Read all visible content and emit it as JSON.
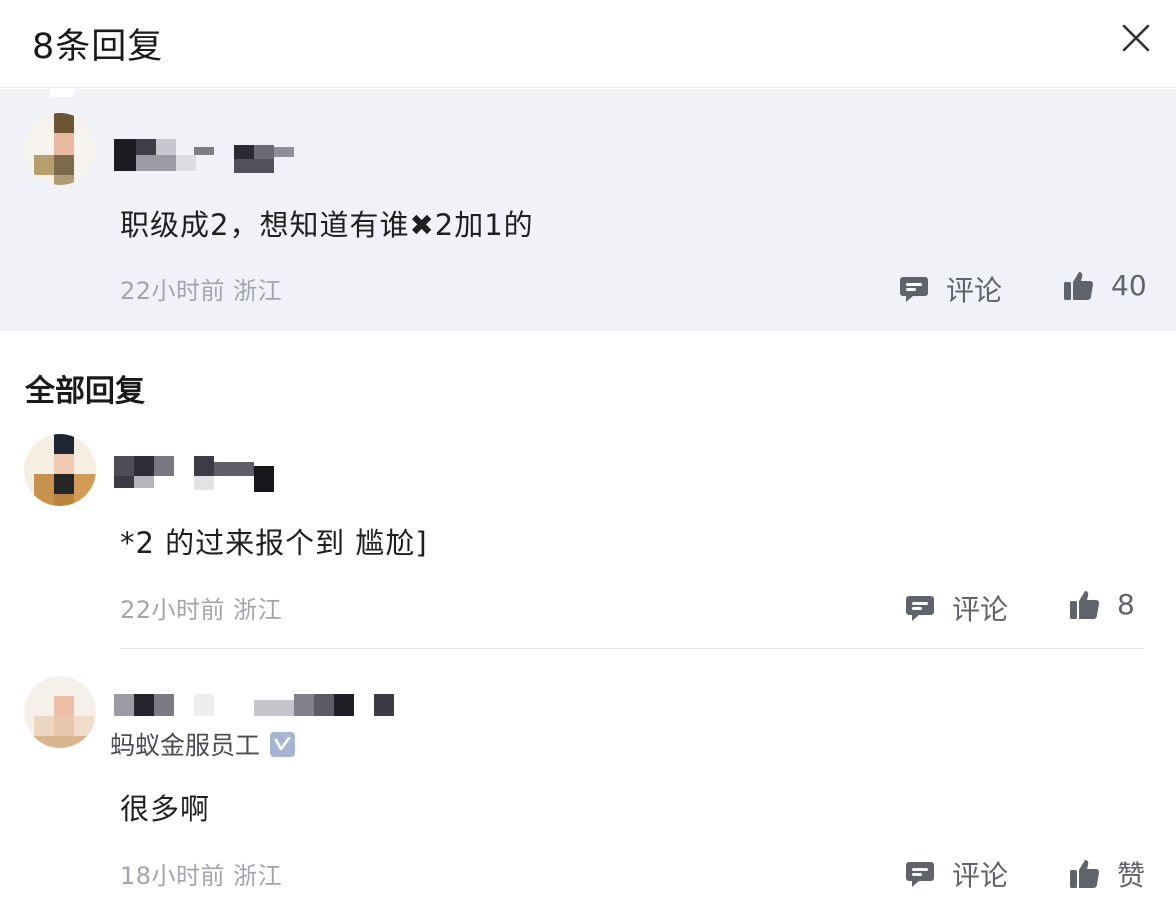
{
  "header": {
    "title": "8条回复"
  },
  "parent": {
    "content": "职级成2，想知道有谁✖2加1的",
    "meta": "22小时前 浙江",
    "comment_label": "评论",
    "like_count": "40"
  },
  "section": {
    "title": "全部回复"
  },
  "replies": [
    {
      "content": "*2 的过来报个到 尴尬]",
      "meta": "22小时前 浙江",
      "comment_label": "评论",
      "like_count": "8"
    },
    {
      "badge": "蚂蚁金服员工",
      "content": "很多啊",
      "meta": "18小时前 浙江",
      "comment_label": "评论",
      "like_count": "赞"
    }
  ],
  "colors": {
    "parent_bg": "#f1f2f7",
    "meta": "#a2a5ad",
    "icon": "#5f636b",
    "verified_badge": "#a8b4d4"
  }
}
